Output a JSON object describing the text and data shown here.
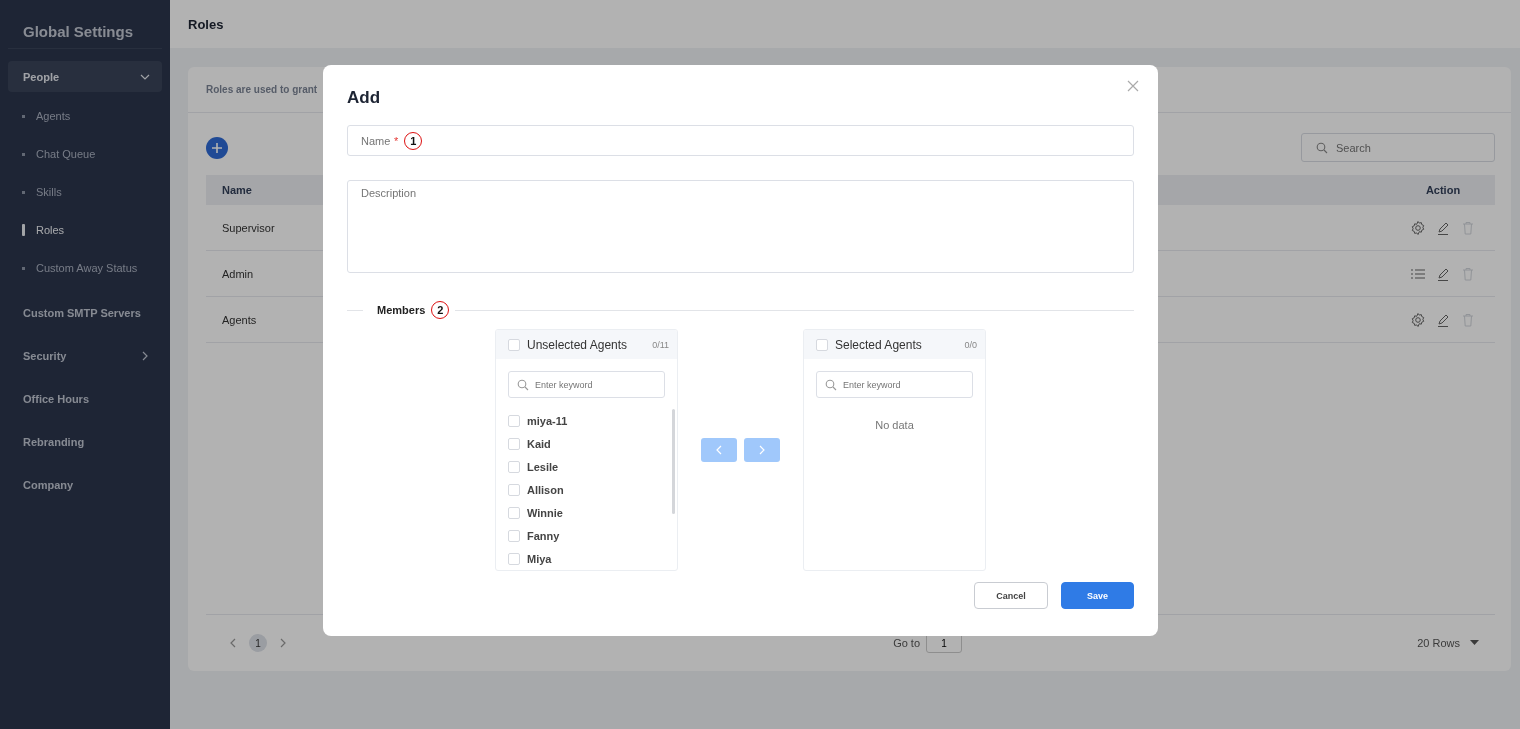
{
  "sidebar": {
    "title": "Global Settings",
    "items": [
      {
        "label": "People",
        "kind": "group",
        "expanded": true,
        "selected": true,
        "children": [
          {
            "label": "Agents",
            "selected": false
          },
          {
            "label": "Chat Queue",
            "selected": false
          },
          {
            "label": "Skills",
            "selected": false
          },
          {
            "label": "Roles",
            "selected": true
          },
          {
            "label": "Custom Away Status",
            "selected": false
          }
        ]
      },
      {
        "label": "Custom SMTP Servers",
        "kind": "link",
        "selected": false
      },
      {
        "label": "Security",
        "kind": "group",
        "expanded": false,
        "selected": false
      },
      {
        "label": "Office Hours",
        "kind": "link",
        "selected": false
      },
      {
        "label": "Rebranding",
        "kind": "link",
        "selected": false
      },
      {
        "label": "Company",
        "kind": "link",
        "selected": false
      }
    ]
  },
  "page": {
    "title": "Roles",
    "description": "Roles are used to grant",
    "search": {
      "placeholder": "Search"
    },
    "table": {
      "columns": [
        "Name",
        "Action"
      ],
      "rows": [
        {
          "name": "Supervisor",
          "actions": [
            {
              "kind": "settings",
              "disabled": false
            },
            {
              "kind": "edit",
              "disabled": false
            },
            {
              "kind": "delete",
              "disabled": true
            }
          ]
        },
        {
          "name": "Admin",
          "actions": [
            {
              "kind": "list",
              "disabled": false
            },
            {
              "kind": "edit",
              "disabled": false
            },
            {
              "kind": "delete",
              "disabled": true
            }
          ]
        },
        {
          "name": "Agents",
          "actions": [
            {
              "kind": "settings",
              "disabled": false
            },
            {
              "kind": "edit",
              "disabled": false
            },
            {
              "kind": "delete",
              "disabled": true
            }
          ]
        }
      ]
    },
    "pagination": {
      "pages": [
        {
          "label": "1",
          "selected": true
        }
      ],
      "go_to": "Go to",
      "go_to_value": "1",
      "rows_per_page": "20 Rows"
    }
  },
  "dialog": {
    "title": "Add",
    "name_field": {
      "placeholder": "Name",
      "required_mark": "*",
      "marker": "1"
    },
    "description_field": {
      "placeholder": "Description"
    },
    "members": {
      "label": "Members",
      "marker": "2"
    },
    "unselected": {
      "title": "Unselected Agents",
      "count": "0/11",
      "checked": false,
      "search_placeholder": "Enter keyword",
      "items": [
        {
          "label": "miya-11",
          "checked": false
        },
        {
          "label": "Kaid",
          "checked": false
        },
        {
          "label": "Lesile",
          "checked": false
        },
        {
          "label": "Allison",
          "checked": false
        },
        {
          "label": "Winnie",
          "checked": false
        },
        {
          "label": "Fanny",
          "checked": false
        },
        {
          "label": "Miya",
          "checked": false
        }
      ]
    },
    "selected": {
      "title": "Selected Agents",
      "count": "0/0",
      "checked": false,
      "search_placeholder": "Enter keyword",
      "empty": "No data"
    },
    "move_buttons": [
      {
        "kind": "left",
        "disabled": true
      },
      {
        "kind": "right",
        "disabled": true
      }
    ],
    "buttons": [
      {
        "label": "Cancel",
        "kind": "secondary"
      },
      {
        "label": "Save",
        "kind": "primary"
      }
    ]
  }
}
